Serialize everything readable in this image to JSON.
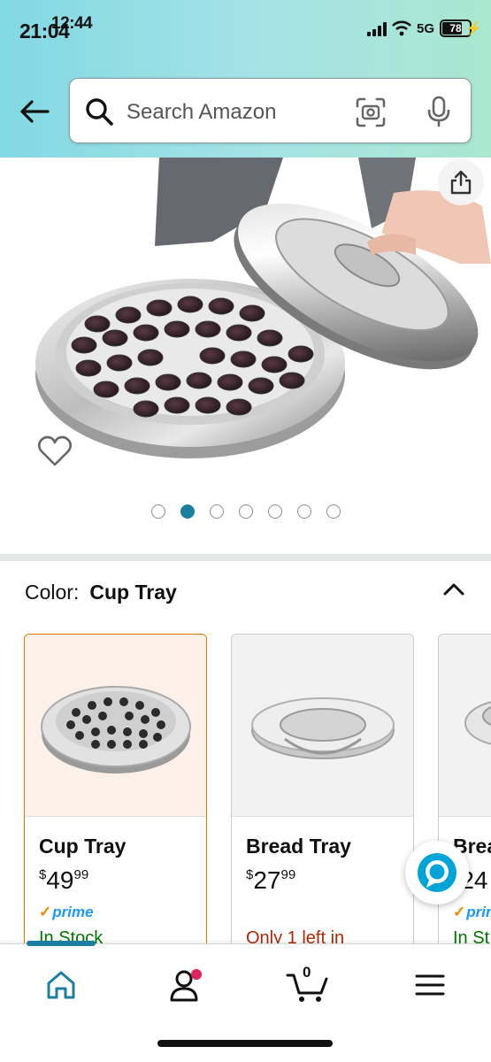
{
  "status_bar": {
    "time": "21:04",
    "time_overlay": "12:44",
    "network": "5G",
    "battery": "78"
  },
  "search": {
    "placeholder": "Search Amazon"
  },
  "icons": {
    "back": "back-arrow-icon",
    "search": "search-icon",
    "camera": "camera-scan-icon",
    "mic": "microphone-icon",
    "share": "share-icon",
    "wishlist": "heart-icon",
    "collapse": "chevron-up-icon",
    "alexa": "alexa-icon",
    "home": "home-icon",
    "account": "person-icon",
    "cart": "cart-icon",
    "menu": "menu-icon"
  },
  "carousel": {
    "total": 7,
    "active_index": 1
  },
  "color_selector": {
    "label": "Color:",
    "selected": "Cup Tray"
  },
  "variants": [
    {
      "name": "Cup Tray",
      "price_symbol": "$",
      "price_whole": "49",
      "price_cents": "99",
      "prime": "prime",
      "stock": "In Stock"
    },
    {
      "name": "Bread Tray",
      "price_symbol": "$",
      "price_whole": "27",
      "price_cents": "99",
      "stock": "Only 1 left in"
    },
    {
      "name": "Brea",
      "price_symbol": "$",
      "price_whole": "24",
      "prime": "prim",
      "stock": "In St"
    }
  ],
  "bottom_nav": {
    "cart_count": "0"
  },
  "colors": {
    "accent": "#1b7fa0",
    "selected_border": "#e77600",
    "prime_blue": "#1a98ff",
    "in_stock": "#007600",
    "low_stock": "#b12704"
  }
}
